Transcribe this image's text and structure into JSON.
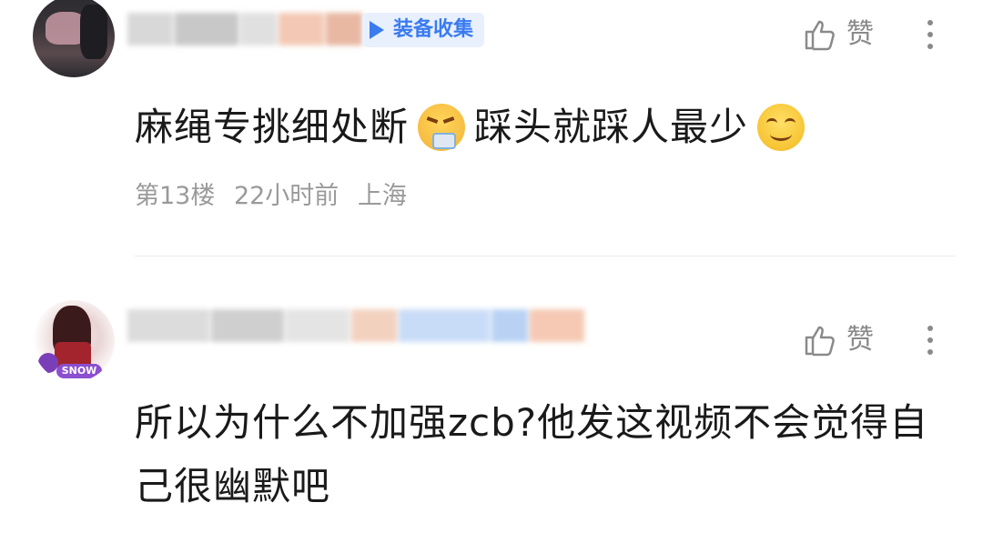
{
  "comments": [
    {
      "tag": "装备收集",
      "text_before": "麻绳专挑细处断",
      "text_middle": "踩头就踩人最少",
      "emoji_1": "angry-face-icon",
      "emoji_2": "smiling-face-icon",
      "floor": "第13楼",
      "time": "22小时前",
      "location": "上海",
      "like_label": "赞"
    },
    {
      "text": "所以为什么不加强zcb?他发这视频不会觉得自己很幽默吧",
      "like_label": "赞",
      "avatar_badge": "SNOW"
    }
  ]
}
